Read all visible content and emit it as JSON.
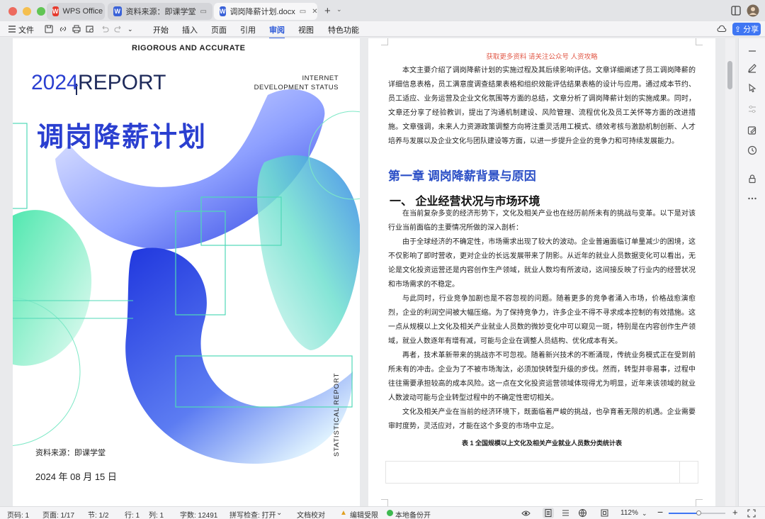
{
  "tabs": [
    {
      "label": "WPS Office"
    },
    {
      "label": "资料来源：即课学堂"
    },
    {
      "label": "调岗降薪计划.docx"
    }
  ],
  "menu": {
    "file": "文件",
    "items": [
      "开始",
      "插入",
      "页面",
      "引用",
      "审阅",
      "视图",
      "特色功能"
    ],
    "active": "审阅",
    "share": "分享"
  },
  "cover": {
    "tagline": "RIGOROUS AND ACCURATE",
    "year": "2024",
    "report": "REPORT",
    "status": [
      "INTERNET",
      "DEVELOPMENT STATUS"
    ],
    "title": "调岗降薪计划",
    "source": "资料来源：即课学堂",
    "date": "2024 年 08 月 15 日",
    "vertical": "STATISTICAL REPORT"
  },
  "doc": {
    "header": "获取更多资料  请关注公众号  人资攻略",
    "intro": "本文主要介绍了调岗降薪计划的实施过程及其后续影响评估。文章详细阐述了员工调岗降薪的详细信息表格，员工满意度调查结果表格和组织效能评估结果表格的设计与应用。通过成本节约、员工适应、业务运营及企业文化氛围等方面的总结，文章分析了调岗降薪计划的实施成果。同时，文章还分享了经验教训，提出了沟通机制建设、风险管理、流程优化及员工关怀等方面的改进措施。文章强调，未来人力资源政策调整方向将注重灵活用工模式、绩效考核与激励机制创新、人才培养与发展以及企业文化与团队建设等方面，以进一步提升企业的竞争力和可持续发展能力。",
    "chapter": "第一章  调岗降薪背景与原因",
    "section": "一、  企业经营状况与市场环境",
    "paragraphs": [
      "在当前复杂多变的经济形势下，文化及相关产业也在经历前所未有的挑战与变革。以下是对该行业当前面临的主要情况所做的深入剖析：",
      "由于全球经济的不确定性，市场需求出现了较大的波动。企业普遍面临订单量减少的困境，这不仅影响了即时营收，更对企业的长远发展带来了阴影。从近年的就业人员数据变化可以看出，无论是文化投资运营还是内容创作生产领域，就业人数均有所波动，这间接反映了行业内的经营状况和市场需求的不稳定。",
      "与此同时，行业竞争加剧也是不容忽视的问题。随着更多的竞争者涌入市场，价格战愈演愈烈，企业的利润空间被大幅压缩。为了保持竞争力，许多企业不得不寻求成本控制的有效措施。这一点从规模以上文化及相关产业就业人员数的微妙变化中可以窥见一斑，特别是在内容创作生产领域，就业人数逐年有增有减，可能与企业在调整人员结构、优化成本有关。",
      "再者，技术革新带来的挑战亦不可忽视。随着新兴技术的不断涌现，传统业务模式正在受到前所未有的冲击。企业为了不被市场淘汰，必须加快转型升级的步伐。然而，转型并非易事，过程中往往需要承担较高的成本风险。这一点在文化投资运营领域体现得尤为明显，近年来该领域的就业人数波动可能与企业转型过程中的不确定性密切相关。",
      "文化及相关产业在当前的经济环境下，既面临着严峻的挑战，也孕育着无限的机遇。企业需要审时度势，灵活应对，才能在这个多变的市场中立足。"
    ],
    "table_caption": "表 1  全国规模以上文化及相关产业就业人员数分类统计表"
  },
  "status": {
    "page": "页码: 1",
    "pages": "页面: 1/17",
    "section": "节: 1/2",
    "row": "行: 1",
    "col": "列: 1",
    "words": "字数: 12491",
    "spell": "拼写检查: 打开",
    "proof": "文档校对",
    "restricted": "编辑受限",
    "backup": "本地备份开",
    "zoom": "112%"
  }
}
